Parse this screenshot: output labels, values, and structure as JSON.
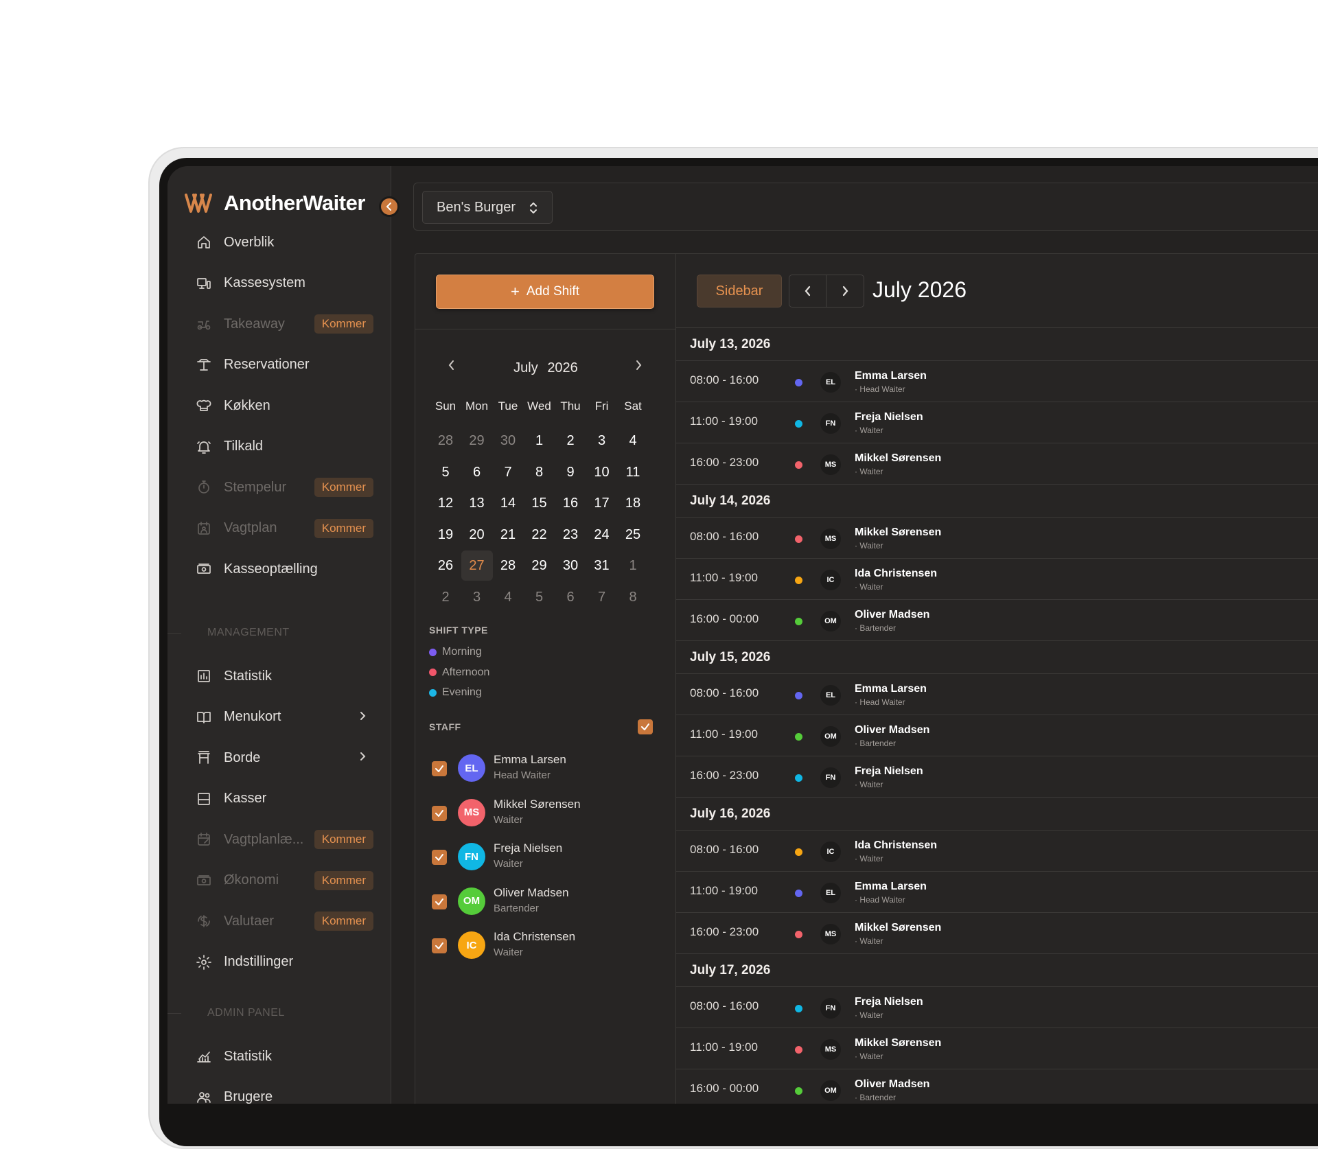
{
  "app": {
    "name": "AnotherWaiter"
  },
  "venue": {
    "name": "Ben's Burger"
  },
  "sidebar": {
    "items": [
      {
        "label": "Overblik",
        "icon": "home-icon",
        "enabled": true
      },
      {
        "label": "Kassesystem",
        "icon": "pos-icon",
        "enabled": true
      },
      {
        "label": "Takeaway",
        "icon": "scooter-icon",
        "enabled": false,
        "badge": "Kommer"
      },
      {
        "label": "Reservationer",
        "icon": "table-icon",
        "enabled": true
      },
      {
        "label": "Køkken",
        "icon": "chef-hat-icon",
        "enabled": true
      },
      {
        "label": "Tilkald",
        "icon": "bell-icon",
        "enabled": true
      },
      {
        "label": "Stempelur",
        "icon": "stopwatch-icon",
        "enabled": false,
        "badge": "Kommer"
      },
      {
        "label": "Vagtplan",
        "icon": "calendar-user-icon",
        "enabled": false,
        "badge": "Kommer"
      },
      {
        "label": "Kasseoptælling",
        "icon": "cash-icon",
        "enabled": true
      }
    ],
    "management_label": "MANAGEMENT",
    "management_items": [
      {
        "label": "Statistik",
        "icon": "chart-icon",
        "enabled": true
      },
      {
        "label": "Menukort",
        "icon": "book-icon",
        "enabled": true,
        "chevron": true
      },
      {
        "label": "Borde",
        "icon": "chair-icon",
        "enabled": true,
        "chevron": true
      },
      {
        "label": "Kasser",
        "icon": "register-icon",
        "enabled": true
      },
      {
        "label": "Vagtplanlæ...",
        "icon": "calendar-edit-icon",
        "enabled": false,
        "badge": "Kommer"
      },
      {
        "label": "Økonomi",
        "icon": "money-icon",
        "enabled": false,
        "badge": "Kommer"
      },
      {
        "label": "Valutaer",
        "icon": "currency-icon",
        "enabled": false,
        "badge": "Kommer"
      },
      {
        "label": "Indstillinger",
        "icon": "gear-icon",
        "enabled": true
      }
    ],
    "admin_label": "ADMIN PANEL",
    "admin_items": [
      {
        "label": "Statistik",
        "icon": "line-chart-icon",
        "enabled": true
      },
      {
        "label": "Brugere",
        "icon": "users-icon",
        "enabled": true
      }
    ]
  },
  "add_shift_label": "Add Shift",
  "mini_calendar": {
    "month": "July",
    "year": "2026",
    "weekdays": [
      "Sun",
      "Mon",
      "Tue",
      "Wed",
      "Thu",
      "Fri",
      "Sat"
    ],
    "weeks": [
      [
        "28",
        "29",
        "30",
        "1",
        "2",
        "3",
        "4"
      ],
      [
        "5",
        "6",
        "7",
        "8",
        "9",
        "10",
        "11"
      ],
      [
        "12",
        "13",
        "14",
        "15",
        "16",
        "17",
        "18"
      ],
      [
        "19",
        "20",
        "21",
        "22",
        "23",
        "24",
        "25"
      ],
      [
        "26",
        "27",
        "28",
        "29",
        "30",
        "31",
        "1"
      ],
      [
        "2",
        "3",
        "4",
        "5",
        "6",
        "7",
        "8"
      ]
    ],
    "today": "27"
  },
  "shift_type": {
    "title": "SHIFT TYPE",
    "items": [
      {
        "label": "Morning",
        "color": "#7c5cf0"
      },
      {
        "label": "Afternoon",
        "color": "#f0566a"
      },
      {
        "label": "Evening",
        "color": "#1cb6e6"
      }
    ]
  },
  "staff": {
    "title": "STAFF",
    "members": [
      {
        "initials": "EL",
        "name": "Emma Larsen",
        "role": "Head Waiter",
        "color": "#6366f1"
      },
      {
        "initials": "MS",
        "name": "Mikkel Sørensen",
        "role": "Waiter",
        "color": "#f2636b"
      },
      {
        "initials": "FN",
        "name": "Freja Nielsen",
        "role": "Waiter",
        "color": "#10b7e4"
      },
      {
        "initials": "OM",
        "name": "Oliver Madsen",
        "role": "Bartender",
        "color": "#55cc3a"
      },
      {
        "initials": "IC",
        "name": "Ida Christensen",
        "role": "Waiter",
        "color": "#f7a613"
      }
    ]
  },
  "calendar_header": {
    "sidebar_label": "Sidebar",
    "title": "July 2026"
  },
  "schedule": [
    {
      "date": "July 13, 2026",
      "shifts": [
        {
          "time": "08:00 - 16:00",
          "dot": "#6366f1",
          "initials": "EL",
          "name": "Emma Larsen",
          "role": "· Head Waiter"
        },
        {
          "time": "11:00 - 19:00",
          "dot": "#10b7e4",
          "initials": "FN",
          "name": "Freja Nielsen",
          "role": "· Waiter"
        },
        {
          "time": "16:00 - 23:00",
          "dot": "#f2636b",
          "initials": "MS",
          "name": "Mikkel Sørensen",
          "role": "· Waiter"
        }
      ]
    },
    {
      "date": "July 14, 2026",
      "shifts": [
        {
          "time": "08:00 - 16:00",
          "dot": "#f2636b",
          "initials": "MS",
          "name": "Mikkel Sørensen",
          "role": "· Waiter"
        },
        {
          "time": "11:00 - 19:00",
          "dot": "#f7a613",
          "initials": "IC",
          "name": "Ida Christensen",
          "role": "· Waiter"
        },
        {
          "time": "16:00 - 00:00",
          "dot": "#55cc3a",
          "initials": "OM",
          "name": "Oliver Madsen",
          "role": "· Bartender"
        }
      ]
    },
    {
      "date": "July 15, 2026",
      "shifts": [
        {
          "time": "08:00 - 16:00",
          "dot": "#6366f1",
          "initials": "EL",
          "name": "Emma Larsen",
          "role": "· Head Waiter"
        },
        {
          "time": "11:00 - 19:00",
          "dot": "#55cc3a",
          "initials": "OM",
          "name": "Oliver Madsen",
          "role": "· Bartender"
        },
        {
          "time": "16:00 - 23:00",
          "dot": "#10b7e4",
          "initials": "FN",
          "name": "Freja Nielsen",
          "role": "· Waiter"
        }
      ]
    },
    {
      "date": "July 16, 2026",
      "shifts": [
        {
          "time": "08:00 - 16:00",
          "dot": "#f7a613",
          "initials": "IC",
          "name": "Ida Christensen",
          "role": "· Waiter"
        },
        {
          "time": "11:00 - 19:00",
          "dot": "#6366f1",
          "initials": "EL",
          "name": "Emma Larsen",
          "role": "· Head Waiter"
        },
        {
          "time": "16:00 - 23:00",
          "dot": "#f2636b",
          "initials": "MS",
          "name": "Mikkel Sørensen",
          "role": "· Waiter"
        }
      ]
    },
    {
      "date": "July 17, 2026",
      "shifts": [
        {
          "time": "08:00 - 16:00",
          "dot": "#10b7e4",
          "initials": "FN",
          "name": "Freja Nielsen",
          "role": "· Waiter"
        },
        {
          "time": "11:00 - 19:00",
          "dot": "#f2636b",
          "initials": "MS",
          "name": "Mikkel Sørensen",
          "role": "· Waiter"
        },
        {
          "time": "16:00 - 00:00",
          "dot": "#55cc3a",
          "initials": "OM",
          "name": "Oliver Madsen",
          "role": "· Bartender"
        }
      ]
    }
  ]
}
